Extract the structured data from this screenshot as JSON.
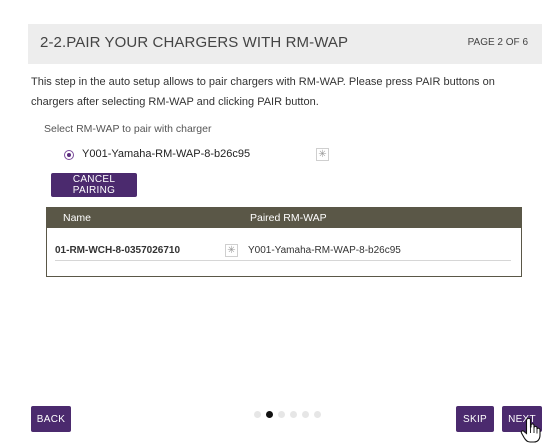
{
  "header": {
    "title": "2-2.PAIR YOUR CHARGERS WITH RM-WAP",
    "page_indicator": "PAGE 2 OF 6"
  },
  "description": "This step in the auto setup allows to pair chargers with RM-WAP. Please press PAIR buttons on chargers after selecting RM-WAP and clicking PAIR button.",
  "select_label": "Select RM-WAP to pair with charger",
  "rmwap_option": {
    "label": "Y001-Yamaha-RM-WAP-8-b26c95",
    "selected": true,
    "icon": "sparkle-icon"
  },
  "cancel_button": "CANCEL PAIRING",
  "table": {
    "columns": [
      "Name",
      "Paired RM-WAP"
    ],
    "rows": [
      {
        "name": "01-RM-WCH-8-0357026710",
        "icon": "sparkle-icon",
        "paired": "Y001-Yamaha-RM-WAP-8-b26c95"
      }
    ]
  },
  "footer": {
    "back_label": "BACK",
    "skip_label": "SKIP",
    "next_label": "NEXT",
    "pager": {
      "total": 6,
      "current": 2
    }
  },
  "colors": {
    "button": "#4b2a6e",
    "table_header": "#5a5747",
    "header_bar": "#ededed"
  }
}
